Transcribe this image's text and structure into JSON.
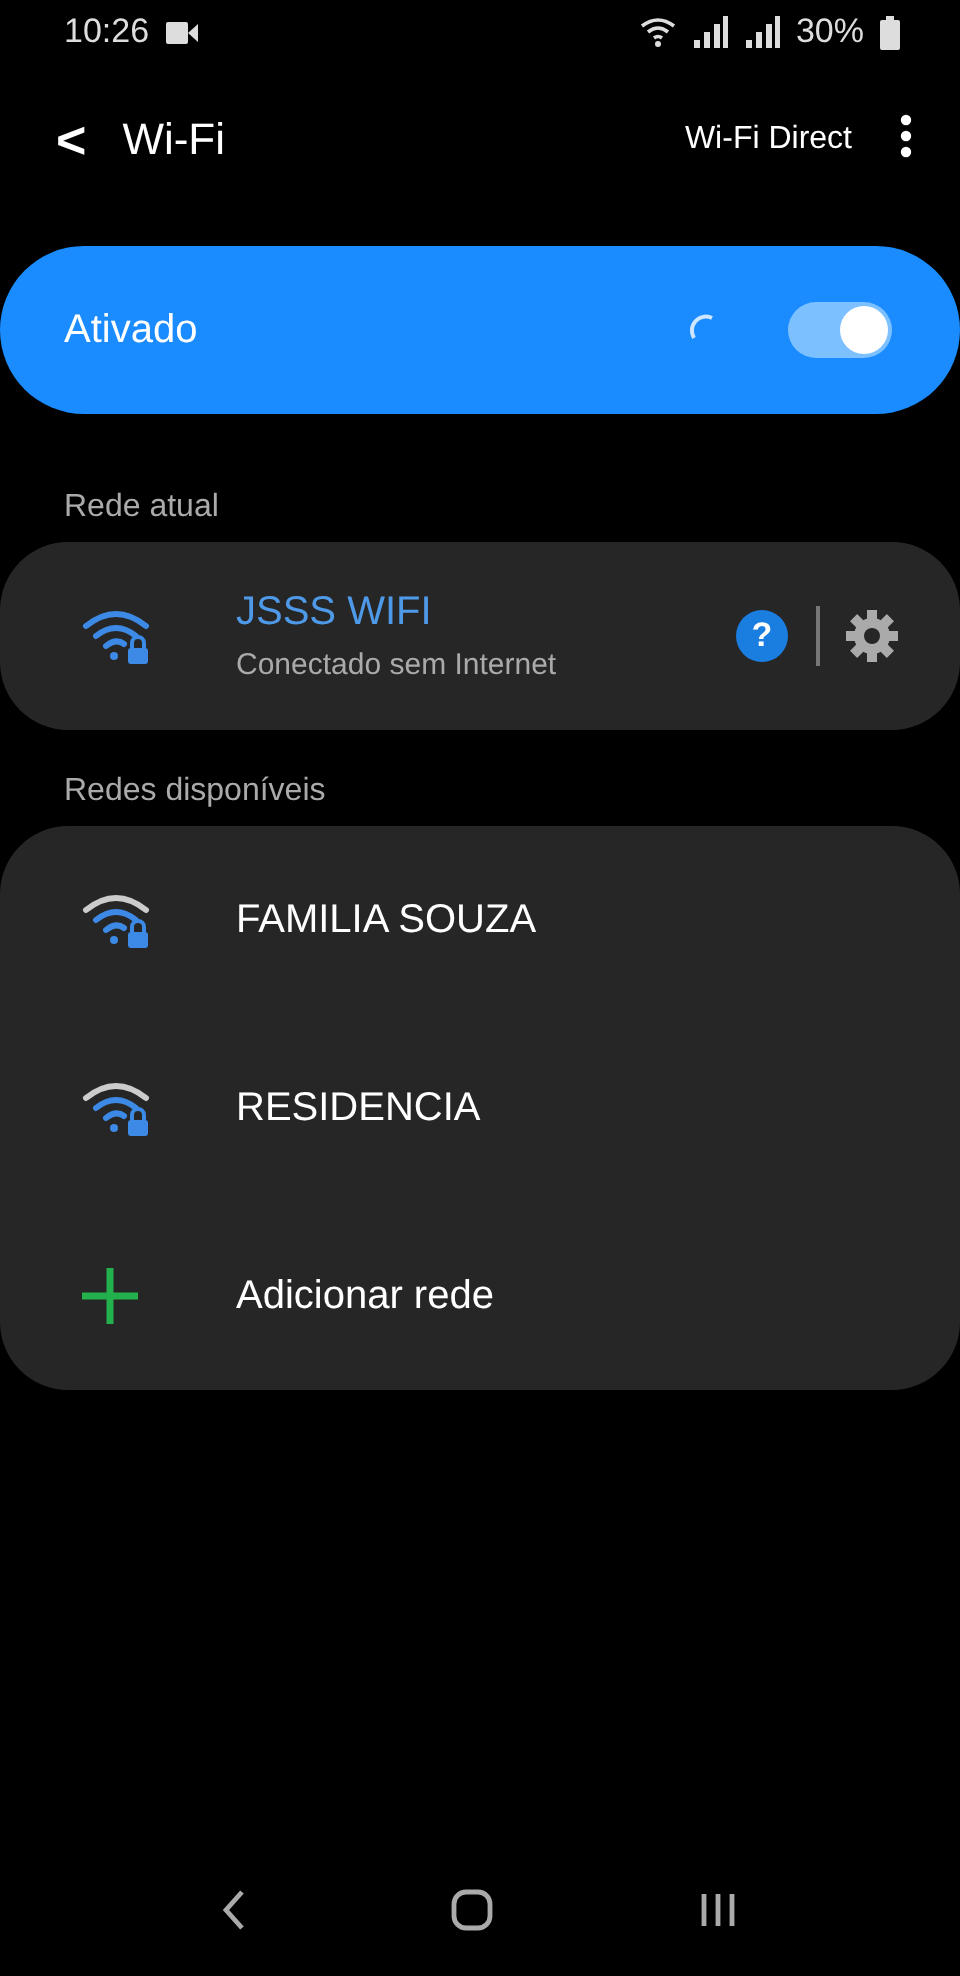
{
  "status_bar": {
    "time": "10:26",
    "battery": "30%"
  },
  "header": {
    "back": "<",
    "title": "Wi-Fi",
    "action": "Wi-Fi Direct"
  },
  "master_switch": {
    "label": "Ativado",
    "on": true,
    "scanning": true
  },
  "current_section": {
    "title": "Rede atual",
    "network": {
      "name": "JSSS WIFI",
      "status": "Conectado sem Internet",
      "help": "?"
    }
  },
  "available_section": {
    "title": "Redes disponíveis",
    "items": [
      {
        "kind": "network",
        "label": "FAMILIA SOUZA"
      },
      {
        "kind": "network",
        "label": "RESIDENCIA"
      },
      {
        "kind": "add",
        "label": "Adicionar rede"
      }
    ]
  }
}
